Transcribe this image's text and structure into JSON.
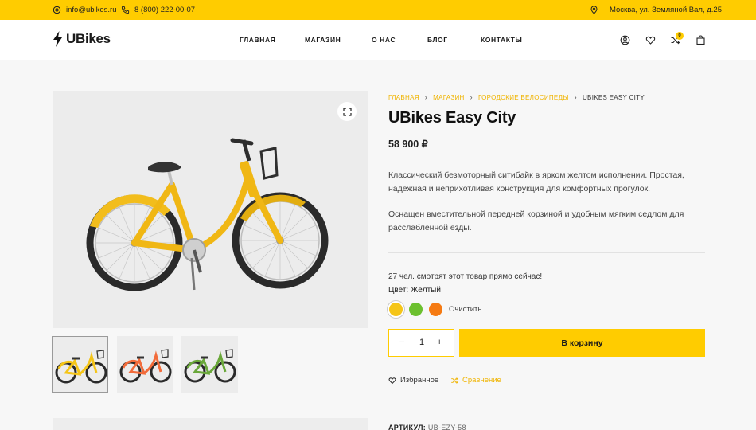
{
  "topbar": {
    "email": "info@ubikes.ru",
    "phone": "8 (800) 222-00-07",
    "address": "Москва, ул. Земляной Вал, д.25"
  },
  "header": {
    "logo": "UBikes",
    "nav": [
      "ГЛАВНАЯ",
      "МАГАЗИН",
      "О НАС",
      "БЛОГ",
      "КОНТАКТЫ"
    ],
    "compare_count": "0"
  },
  "product": {
    "breadcrumb": [
      "ГЛАВНАЯ",
      "МАГАЗИН",
      "ГОРОДСКИЕ ВЕЛОСИПЕДЫ",
      "UBIKES EASY CITY"
    ],
    "title": "UBikes Easy City",
    "price": "58 900 ₽",
    "desc1_line1": "Классический безмоторный ситибайк в ярком желтом исполнении. Простая,",
    "desc1_line2": "надежная и неприхотливая конструкция для комфортных прогулок.",
    "desc2_line1": "Оснащен вместительной передней корзиной и удобным мягким седлом для",
    "desc2_line2": "расслабленной езды.",
    "viewers": "27 чел. смотрят этот товар прямо сейчас!",
    "color_label": "Цвет: Жёлтый",
    "colors": [
      "#f5c518",
      "#6cc02e",
      "#f57a12"
    ],
    "clear_label": "Очистить",
    "qty_minus": "−",
    "qty_value": "1",
    "qty_plus": "+",
    "add_to_cart": "В корзину",
    "wishlist": "Избранное",
    "compare": "Сравнение",
    "sku_label": "АРТИКУЛ:",
    "sku_value": "UB-EZY-58"
  },
  "gallery": {
    "thumb_frames": [
      "#f5c518",
      "#f26b3a",
      "#6aa83a"
    ]
  },
  "colors": {
    "accent": "#ffcc00",
    "link": "#f0b400"
  }
}
